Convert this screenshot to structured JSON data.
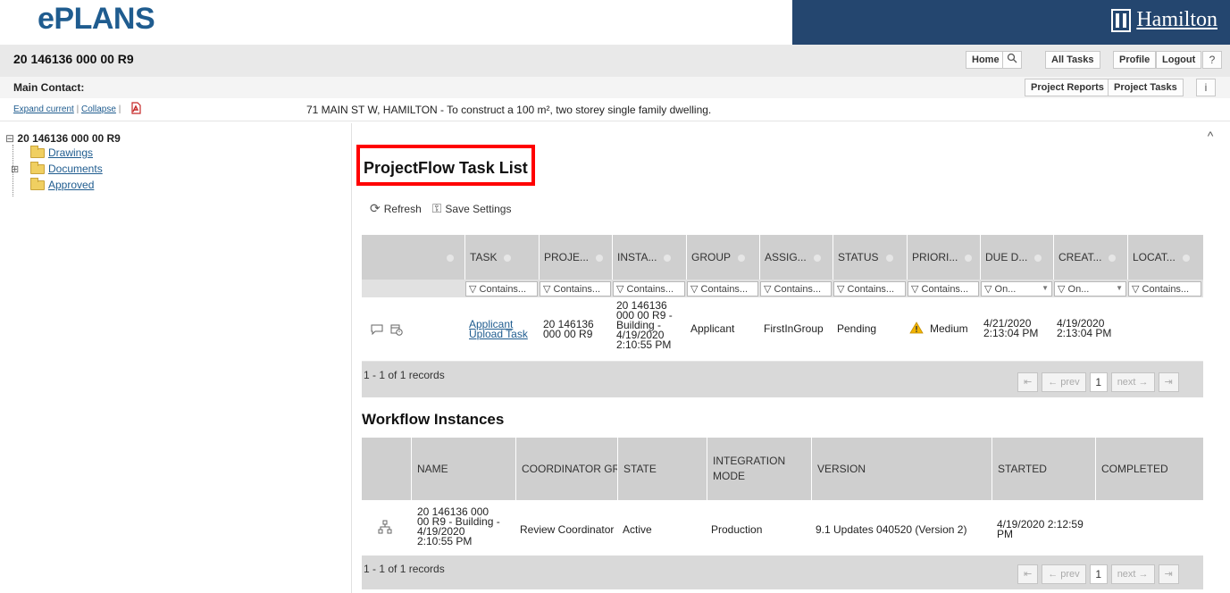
{
  "header": {
    "logo": "ePLANS",
    "brand": "Hamilton",
    "colors": {
      "brand_bg": "#24466f",
      "logo": "#1f5c8f",
      "highlight": "#ff0000"
    }
  },
  "project": {
    "id": "20 146136 000 00 R9",
    "main_contact_label": "Main Contact:",
    "expand_label": "Expand current",
    "collapse_label": "Collapse",
    "description": "71 MAIN ST W, HAMILTON - To construct a 100 m², two storey single family dwelling."
  },
  "topnav": {
    "home": "Home",
    "all_tasks": "All Tasks",
    "profile": "Profile",
    "logout": "Logout",
    "project_reports": "Project Reports",
    "project_tasks": "Project Tasks"
  },
  "tree": {
    "root": "20 146136 000 00 R9",
    "items": [
      {
        "label": "Drawings",
        "icon": "folder-icon"
      },
      {
        "label": "Documents",
        "icon": "folder-icon"
      },
      {
        "label": "Approved",
        "icon": "folder-icon"
      }
    ]
  },
  "tasklist": {
    "title": "ProjectFlow Task List",
    "refresh": "Refresh",
    "save_settings": "Save Settings",
    "columns": [
      "TASK",
      "PROJE...",
      "INSTA...",
      "GROUP",
      "ASSIG...",
      "STATUS",
      "PRIORI...",
      "DUE D...",
      "CREAT...",
      "LOCAT..."
    ],
    "filters": [
      "Contains...",
      "Contains...",
      "Contains...",
      "Contains...",
      "Contains...",
      "Contains...",
      "Contains...",
      "On...",
      "On...",
      "Contains..."
    ],
    "row": {
      "task": "Applicant Upload Task",
      "project": "20 146136 000 00 R9",
      "instance": "20 146136 000 00 R9 - Building - 4/19/2020 2:10:55 PM",
      "group": "Applicant",
      "assign": "FirstInGroup",
      "status": "Pending",
      "priority": "Medium",
      "due": "4/21/2020 2:13:04 PM",
      "created": "4/19/2020 2:13:04 PM"
    },
    "records": "1 - 1 of 1 records",
    "pager": {
      "first": "⇤",
      "prev": "← prev",
      "page": "1",
      "next": "next →",
      "last": "⇥"
    }
  },
  "workflow": {
    "title": "Workflow Instances",
    "columns": [
      "NAME",
      "COORDINATOR GROUP",
      "STATE",
      "INTEGRATION MODE",
      "VERSION",
      "STARTED",
      "COMPLETED"
    ],
    "row": {
      "name": "20 146136 000 00 R9 - Building - 4/19/2020 2:10:55 PM",
      "coordinator": "Review Coordinator",
      "state": "Active",
      "mode": "Production",
      "version": "9.1 Updates 040520 (Version 2)",
      "started": "4/19/2020 2:12:59 PM",
      "completed": ""
    },
    "records": "1 - 1 of 1 records",
    "pager": {
      "first": "⇤",
      "prev": "← prev",
      "page": "1",
      "next": "next →",
      "last": "⇥"
    }
  }
}
